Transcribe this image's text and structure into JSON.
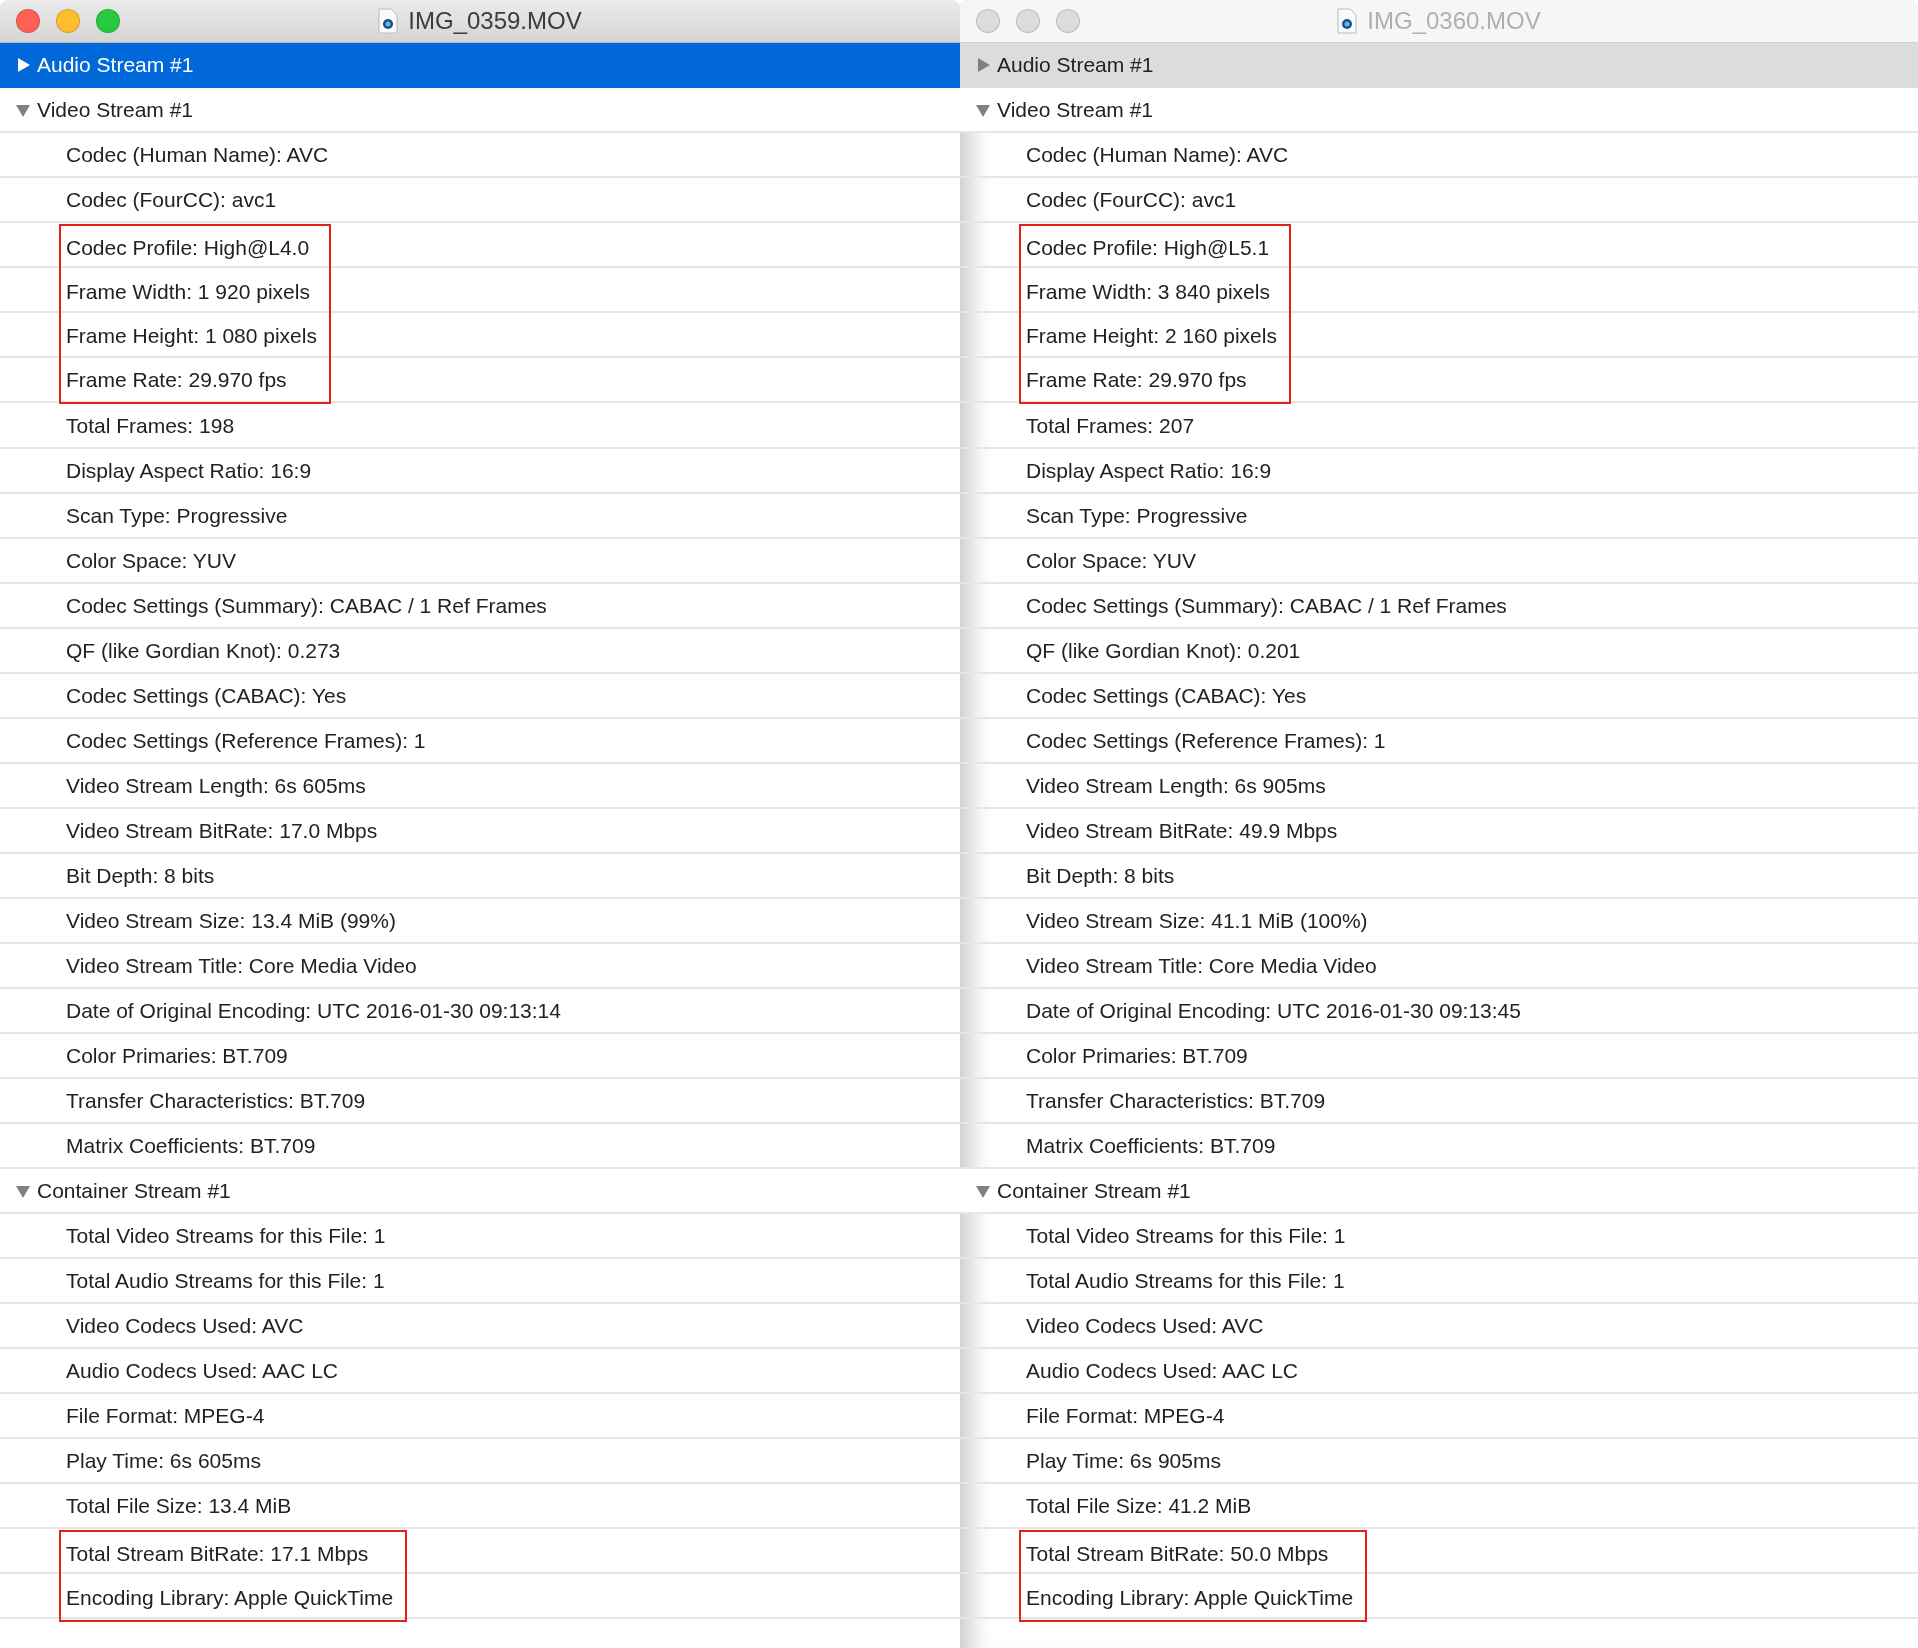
{
  "windows": [
    {
      "title": "IMG_0359.MOV",
      "focused": true,
      "groups": [
        {
          "label": "Audio Stream #1",
          "expanded": false,
          "selected": true
        },
        {
          "label": "Video Stream #1",
          "expanded": true,
          "selected": false,
          "items": [
            {
              "text": "Codec (Human Name): AVC",
              "outlined": false
            },
            {
              "text": "Codec (FourCC): avc1",
              "outlined": false
            },
            {
              "text": "Codec Profile: High@L4.0",
              "outlined": true
            },
            {
              "text": "Frame Width: 1 920 pixels",
              "outlined": true
            },
            {
              "text": "Frame Height: 1 080 pixels",
              "outlined": true
            },
            {
              "text": "Frame Rate: 29.970 fps",
              "outlined": true
            },
            {
              "text": "Total Frames: 198",
              "outlined": false
            },
            {
              "text": "Display Aspect Ratio: 16:9",
              "outlined": false
            },
            {
              "text": "Scan Type: Progressive",
              "outlined": false
            },
            {
              "text": "Color Space: YUV",
              "outlined": false
            },
            {
              "text": "Codec Settings (Summary): CABAC / 1 Ref Frames",
              "outlined": false
            },
            {
              "text": "QF (like Gordian Knot): 0.273",
              "outlined": false
            },
            {
              "text": "Codec Settings (CABAC): Yes",
              "outlined": false
            },
            {
              "text": "Codec Settings (Reference Frames): 1",
              "outlined": false
            },
            {
              "text": "Video Stream Length: 6s 605ms",
              "outlined": false
            },
            {
              "text": "Video Stream BitRate: 17.0 Mbps",
              "outlined": false
            },
            {
              "text": "Bit Depth: 8 bits",
              "outlined": false
            },
            {
              "text": "Video Stream Size: 13.4 MiB (99%)",
              "outlined": false
            },
            {
              "text": "Video Stream Title: Core Media Video",
              "outlined": false
            },
            {
              "text": "Date of Original Encoding: UTC 2016-01-30 09:13:14",
              "outlined": false
            },
            {
              "text": "Color Primaries: BT.709",
              "outlined": false
            },
            {
              "text": "Transfer Characteristics: BT.709",
              "outlined": false
            },
            {
              "text": "Matrix Coefficients: BT.709",
              "outlined": false
            }
          ]
        },
        {
          "label": "Container Stream #1",
          "expanded": true,
          "selected": false,
          "items": [
            {
              "text": "Total Video Streams for this File: 1",
              "outlined": false
            },
            {
              "text": "Total Audio Streams for this File: 1",
              "outlined": false
            },
            {
              "text": "Video Codecs Used: AVC",
              "outlined": false
            },
            {
              "text": "Audio Codecs Used: AAC LC",
              "outlined": false
            },
            {
              "text": "File Format: MPEG-4",
              "outlined": false
            },
            {
              "text": "Play Time: 6s 605ms",
              "outlined": false
            },
            {
              "text": "Total File Size: 13.4 MiB",
              "outlined": false
            },
            {
              "text": "Total Stream BitRate: 17.1 Mbps",
              "outlined": true
            },
            {
              "text": "Encoding Library: Apple QuickTime",
              "outlined": true
            }
          ]
        }
      ]
    },
    {
      "title": "IMG_0360.MOV",
      "focused": false,
      "groups": [
        {
          "label": "Audio Stream #1",
          "expanded": false,
          "selected": true
        },
        {
          "label": "Video Stream #1",
          "expanded": true,
          "selected": false,
          "items": [
            {
              "text": "Codec (Human Name): AVC",
              "outlined": false
            },
            {
              "text": "Codec (FourCC): avc1",
              "outlined": false
            },
            {
              "text": "Codec Profile: High@L5.1",
              "outlined": true
            },
            {
              "text": "Frame Width: 3 840 pixels",
              "outlined": true
            },
            {
              "text": "Frame Height: 2 160 pixels",
              "outlined": true
            },
            {
              "text": "Frame Rate: 29.970 fps",
              "outlined": true
            },
            {
              "text": "Total Frames: 207",
              "outlined": false
            },
            {
              "text": "Display Aspect Ratio: 16:9",
              "outlined": false
            },
            {
              "text": "Scan Type: Progressive",
              "outlined": false
            },
            {
              "text": "Color Space: YUV",
              "outlined": false
            },
            {
              "text": "Codec Settings (Summary): CABAC / 1 Ref Frames",
              "outlined": false
            },
            {
              "text": "QF (like Gordian Knot): 0.201",
              "outlined": false
            },
            {
              "text": "Codec Settings (CABAC): Yes",
              "outlined": false
            },
            {
              "text": "Codec Settings (Reference Frames): 1",
              "outlined": false
            },
            {
              "text": "Video Stream Length: 6s 905ms",
              "outlined": false
            },
            {
              "text": "Video Stream BitRate: 49.9 Mbps",
              "outlined": false
            },
            {
              "text": "Bit Depth: 8 bits",
              "outlined": false
            },
            {
              "text": "Video Stream Size: 41.1 MiB (100%)",
              "outlined": false
            },
            {
              "text": "Video Stream Title: Core Media Video",
              "outlined": false
            },
            {
              "text": "Date of Original Encoding: UTC 2016-01-30 09:13:45",
              "outlined": false
            },
            {
              "text": "Color Primaries: BT.709",
              "outlined": false
            },
            {
              "text": "Transfer Characteristics: BT.709",
              "outlined": false
            },
            {
              "text": "Matrix Coefficients: BT.709",
              "outlined": false
            }
          ]
        },
        {
          "label": "Container Stream #1",
          "expanded": true,
          "selected": false,
          "items": [
            {
              "text": "Total Video Streams for this File: 1",
              "outlined": false
            },
            {
              "text": "Total Audio Streams for this File: 1",
              "outlined": false
            },
            {
              "text": "Video Codecs Used: AVC",
              "outlined": false
            },
            {
              "text": "Audio Codecs Used: AAC LC",
              "outlined": false
            },
            {
              "text": "File Format: MPEG-4",
              "outlined": false
            },
            {
              "text": "Play Time: 6s 905ms",
              "outlined": false
            },
            {
              "text": "Total File Size: 41.2 MiB",
              "outlined": false
            },
            {
              "text": "Total Stream BitRate: 50.0 Mbps",
              "outlined": true
            },
            {
              "text": "Encoding Library: Apple QuickTime",
              "outlined": true
            }
          ]
        }
      ]
    }
  ]
}
